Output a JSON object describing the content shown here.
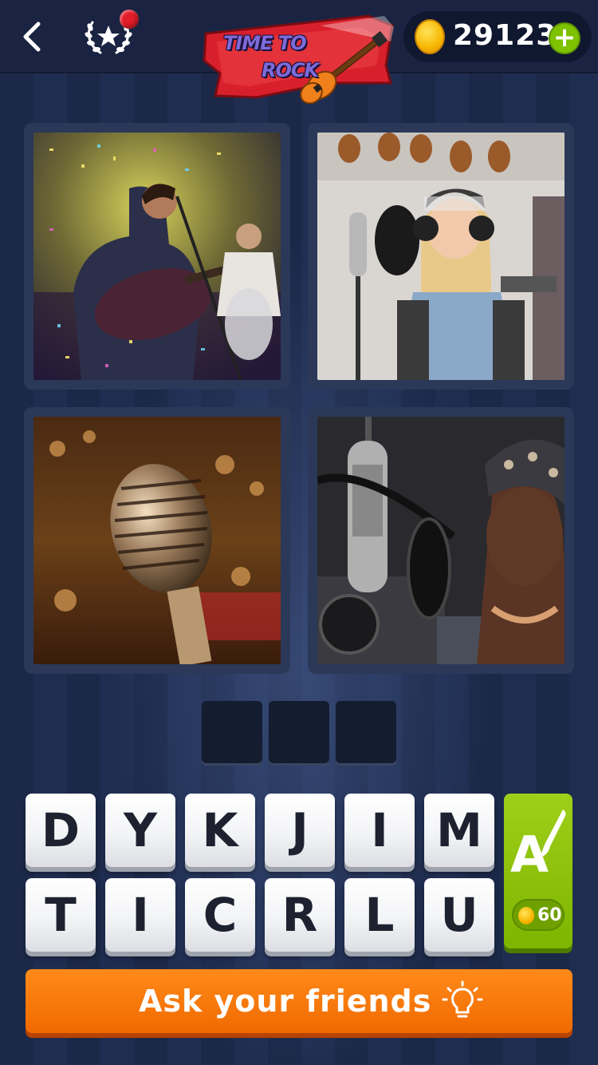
{
  "header": {
    "back_icon": "chevron-left-icon",
    "awards_icon": "laurel-star-icon",
    "notification_dot_color": "#e21d2a",
    "logo_line1": "TIME TO",
    "logo_line2": "ROCK",
    "coin_icon": "coin-icon",
    "coins": "29123",
    "add_coins_label": "+"
  },
  "puzzle": {
    "images": [
      "concert-guitarist-photo",
      "girl-singing-studio-photo",
      "vintage-microphone-photo",
      "woman-studio-microphone-photo"
    ],
    "answer_slots": 3
  },
  "keyboard": {
    "row1": [
      "D",
      "Y",
      "K",
      "J",
      "I",
      "M"
    ],
    "row2": [
      "T",
      "I",
      "C",
      "R",
      "L",
      "U"
    ]
  },
  "hint": {
    "letter": "A",
    "icon": "paintbrush-icon",
    "cost": "60",
    "color": "#8cc300"
  },
  "ask_friends": {
    "label": "Ask your friends",
    "icon": "lightbulb-icon",
    "color": "#f77b0c"
  }
}
